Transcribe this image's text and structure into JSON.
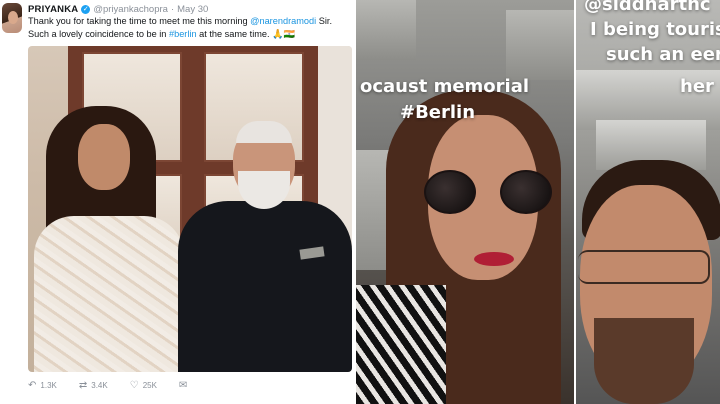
{
  "tweet": {
    "display_name": "PRIYANKA",
    "handle": "@priyankachopra",
    "separator": "·",
    "date": "May 30",
    "text_part1": "Thank you for taking the time to meet me this morning ",
    "mention": "@narendramodi",
    "text_part2": " Sir. Such a lovely coincidence to be in ",
    "hashtag": "#berlin",
    "text_part3": " at the same time. 🙏🇮🇳",
    "actions": {
      "reply_count": "1.3K",
      "retweet_count": "3.4K",
      "like_count": "25K"
    },
    "verified_color": "#1da1f2",
    "link_color": "#1b95e0"
  },
  "story1": {
    "caption_line1": "ocaust memorial",
    "caption_line2": "#Berlin"
  },
  "story2": {
    "caption_line1": "@siddharthc",
    "caption_line2": "I being touris",
    "caption_line3": "such an eer",
    "caption_line4": "her"
  },
  "icons": {
    "verified": "verified-badge-icon",
    "reply": "reply-icon",
    "retweet": "retweet-icon",
    "like": "heart-icon",
    "dm": "message-icon"
  }
}
